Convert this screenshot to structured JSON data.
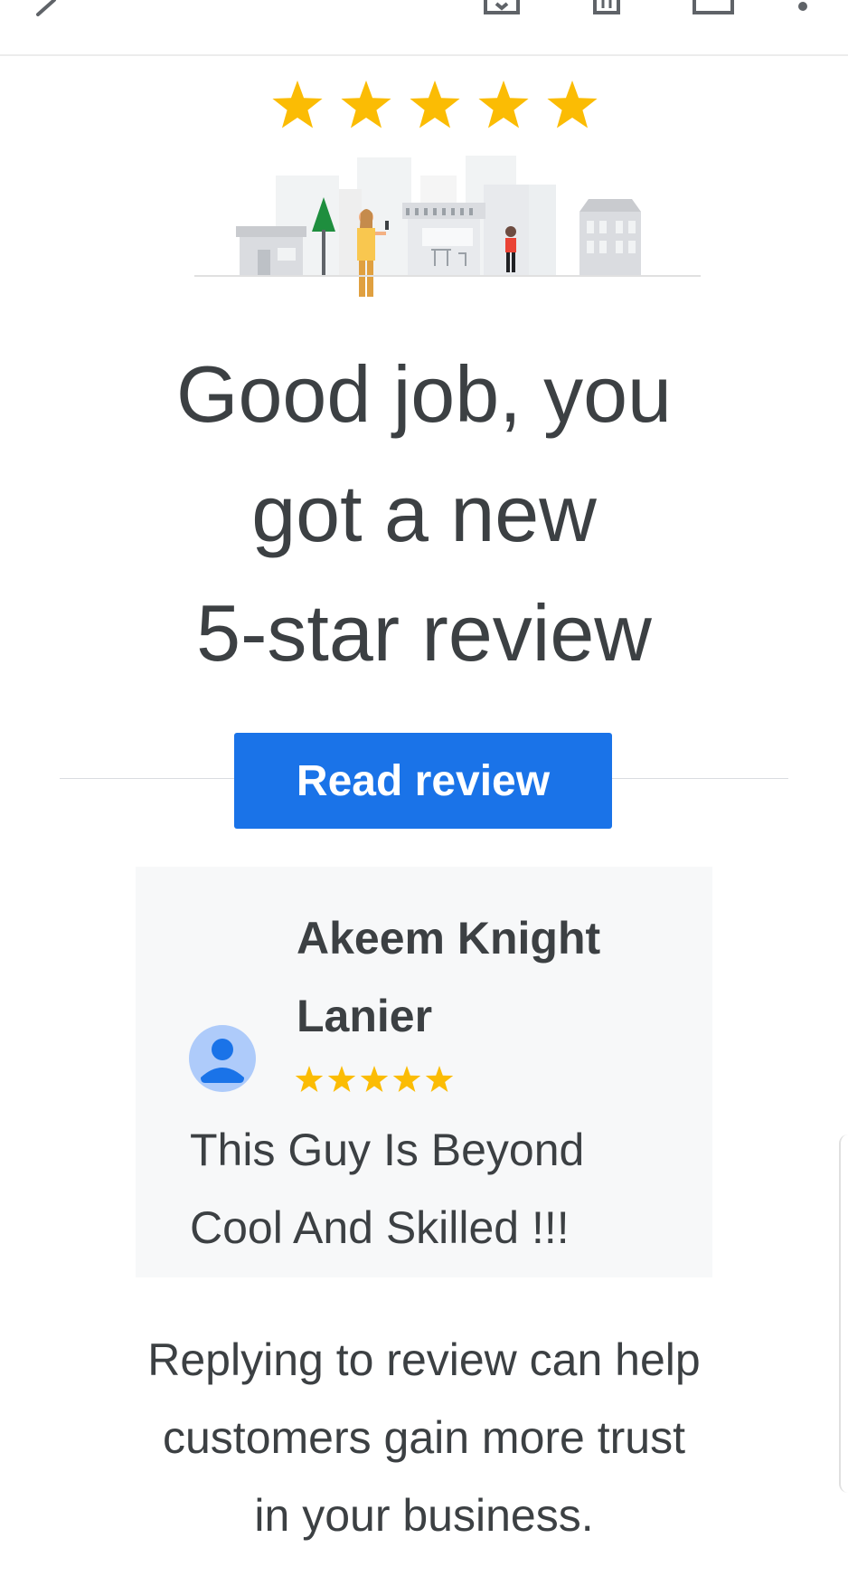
{
  "toolbar": {
    "icons": [
      "back-arrow-icon",
      "archive-icon",
      "delete-icon",
      "mail-icon",
      "more-vert-icon"
    ]
  },
  "rating": {
    "stars": 5,
    "star_color": "#fbbc04"
  },
  "headline": {
    "line1": "Good job, you",
    "line2": "got a new",
    "line3": "5-star review"
  },
  "cta": {
    "label": "Read review",
    "color": "#1a73e8"
  },
  "review": {
    "author_line1": "Akeem Knight",
    "author_line2": "Lanier",
    "stars": 5,
    "text_line1": "This Guy Is Beyond",
    "text_line2": "Cool And Skilled !!!",
    "avatar_color": "#aecbfa"
  },
  "footer": {
    "line1": "Replying to review can help",
    "line2": "customers gain more trust",
    "line3": "in your business."
  }
}
